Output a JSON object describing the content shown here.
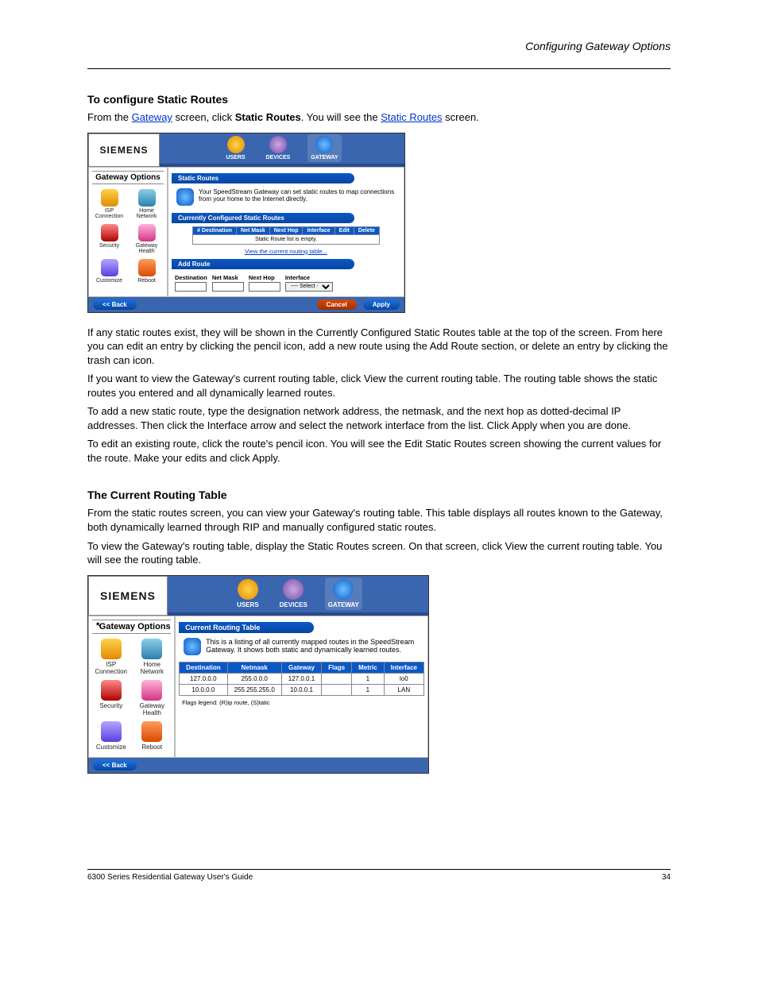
{
  "header_right": "Configuring Gateway Options",
  "sections": {
    "static_routes": {
      "title": "To configure Static Routes",
      "intro_prefix": "From the ",
      "intro_link": "Gateway",
      "intro_mid": " screen, click ",
      "intro_bold": "Static Routes",
      "intro_suffix_prefix": ". You will see the ",
      "intro_suffix_link": "Static Routes",
      "intro_suffix_end": " screen.",
      "after1": "If any static routes exist, they will be shown in the Currently Configured Static Routes table at the top of the screen. From here you can edit an entry by clicking the pencil icon, add a new route using the Add Route section, or delete an entry by clicking the trash can icon.",
      "after2": "If you want to view the Gateway's current routing table, click View the current routing table. The routing table shows the static routes you entered and all dynamically learned routes.",
      "after3": "To add a new static route, type the designation network address, the netmask, and the next hop as dotted-decimal IP addresses. Then click the Interface arrow and select the network interface from the list. Click Apply when you are done.",
      "after4": "To edit an existing route, click the route's pencil icon. You will see the Edit Static Routes screen showing the current values for the route. Make your edits and click Apply."
    },
    "routing_table": {
      "title": "The Current Routing Table",
      "para1": "From the static routes screen, you can view your Gateway's routing table. This table displays all routes known to the Gateway, both dynamically learned through RIP and manually configured static routes.",
      "para2": "To view the Gateway's routing table, display the Static Routes screen. On that screen, click View the current routing table. You will see the routing table."
    }
  },
  "figure1": {
    "brand": "SIEMENS",
    "top_tabs": {
      "users": "USERS",
      "devices": "DEVICES",
      "gateway": "GATEWAY"
    },
    "sidebar_title": "Gateway Options",
    "sidebar_items": {
      "isp": "ISP Connection",
      "home": "Home Network",
      "security": "Security",
      "health": "Gateway Health",
      "customize": "Customize",
      "reboot": "Reboot"
    },
    "pill_static": "Static Routes",
    "desc": "Your SpeedStream Gateway can set static routes to map connections from your home to the Internet directly.",
    "pill_current": "Currently Configured Static Routes",
    "table_headers": [
      "# Destination",
      "Net Mask",
      "Next Hop",
      "Interface",
      "Edit",
      "Delete"
    ],
    "empty_msg": "Static Route list is empty.",
    "view_link": "View the current routing table...",
    "pill_add": "Add Route",
    "add_labels": {
      "dest": "Destination",
      "mask": "Net Mask",
      "hop": "Next Hop",
      "iface": "Interface"
    },
    "iface_selected": "---- Select ----",
    "buttons": {
      "back": "<< Back",
      "cancel": "Cancel",
      "apply": "Apply"
    }
  },
  "figure2": {
    "brand": "SIEMENS",
    "top_tabs": {
      "users": "USERS",
      "devices": "DEVICES",
      "gateway": "GATEWAY"
    },
    "sidebar_title": "Gateway Options",
    "sidebar_items": {
      "isp": "ISP Connection",
      "home": "Home Network",
      "security": "Security",
      "health": "Gateway Health",
      "customize": "Customize",
      "reboot": "Reboot"
    },
    "pill_current": "Current Routing Table",
    "desc": "This is a listing of all currently mapped routes in the SpeedStream Gateway. It shows both static and dynamically learned routes.",
    "table_headers": [
      "Destination",
      "Netmask",
      "Gateway",
      "Flags",
      "Metric",
      "Interface"
    ],
    "rows": [
      {
        "dest": "127.0.0.0",
        "mask": "255.0.0.0",
        "gw": "127.0.0.1",
        "flags": "",
        "metric": "1",
        "iface": "lo0"
      },
      {
        "dest": "10.0.0.0",
        "mask": "255.255.255.0",
        "gw": "10.0.0.1",
        "flags": "",
        "metric": "1",
        "iface": "LAN"
      }
    ],
    "legend": "Flags legend: (R)ip route, (S)tatic",
    "buttons": {
      "back": "<< Back"
    }
  },
  "footer": {
    "left": "6300 Series Residential Gateway User's Guide",
    "right": "34"
  }
}
